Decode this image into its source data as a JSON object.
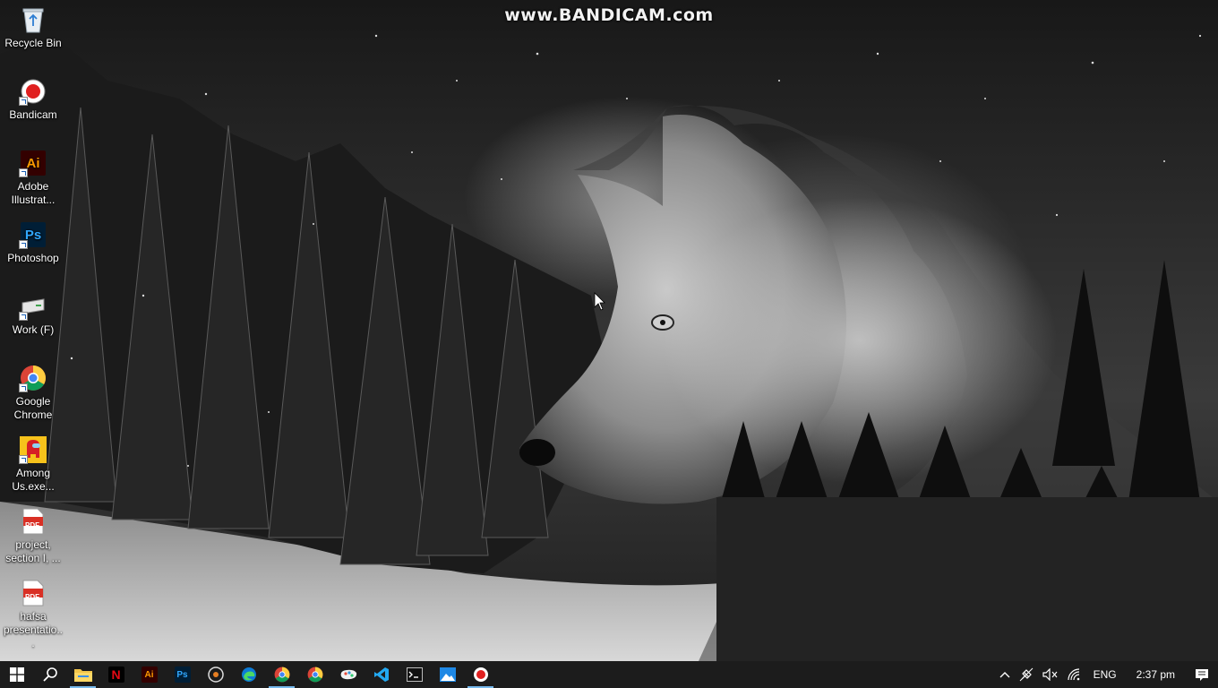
{
  "watermark": "www.BANDICAM.com",
  "desktop": {
    "icons": [
      {
        "label": "Recycle Bin",
        "icon": "recycle-bin-icon"
      },
      {
        "label": "Bandicam",
        "icon": "bandicam-icon"
      },
      {
        "label": "Adobe Illustrat...",
        "icon": "adobe-illustrator-icon",
        "glyph": "Ai"
      },
      {
        "label": "Photoshop",
        "icon": "photoshop-icon",
        "glyph": "Ps"
      },
      {
        "label": "Work (F)",
        "icon": "drive-icon"
      },
      {
        "label": "Google Chrome",
        "icon": "chrome-icon"
      },
      {
        "label": "Among Us.exe...",
        "icon": "among-us-icon"
      },
      {
        "label": "project, section I, ...",
        "icon": "pdf-file-icon",
        "glyph": "PDF"
      },
      {
        "label": "hafsa presentatio...",
        "icon": "pdf-file-icon",
        "glyph": "PDF"
      }
    ]
  },
  "taskbar": {
    "apps": [
      {
        "name": "start",
        "icon": "windows-start-icon"
      },
      {
        "name": "search",
        "icon": "search-icon"
      },
      {
        "name": "file-explorer",
        "icon": "folder-icon"
      },
      {
        "name": "netflix",
        "icon": "netflix-icon",
        "glyph": "N"
      },
      {
        "name": "illustrator",
        "icon": "adobe-illustrator-icon",
        "glyph": "Ai"
      },
      {
        "name": "photoshop",
        "icon": "photoshop-icon",
        "glyph": "Ps"
      },
      {
        "name": "media-player",
        "icon": "media-player-icon"
      },
      {
        "name": "edge",
        "icon": "edge-icon"
      },
      {
        "name": "chrome",
        "icon": "chrome-icon"
      },
      {
        "name": "chrome-2",
        "icon": "chrome-icon"
      },
      {
        "name": "paint-3d",
        "icon": "paint-icon"
      },
      {
        "name": "vscode",
        "icon": "vscode-icon"
      },
      {
        "name": "terminal",
        "icon": "terminal-icon"
      },
      {
        "name": "photos",
        "icon": "photos-icon"
      },
      {
        "name": "bandicam",
        "icon": "record-icon"
      }
    ],
    "tray": {
      "language": "ENG",
      "time": "2:37 pm"
    }
  },
  "colors": {
    "taskbar": "#1c1c1c",
    "accent": "#76b9ed",
    "illustrator": "#330000",
    "illustrator_text": "#ff9a00",
    "photoshop": "#001e36",
    "photoshop_text": "#31a8ff",
    "netflix": "#e50914",
    "pdf": "#d93025"
  }
}
